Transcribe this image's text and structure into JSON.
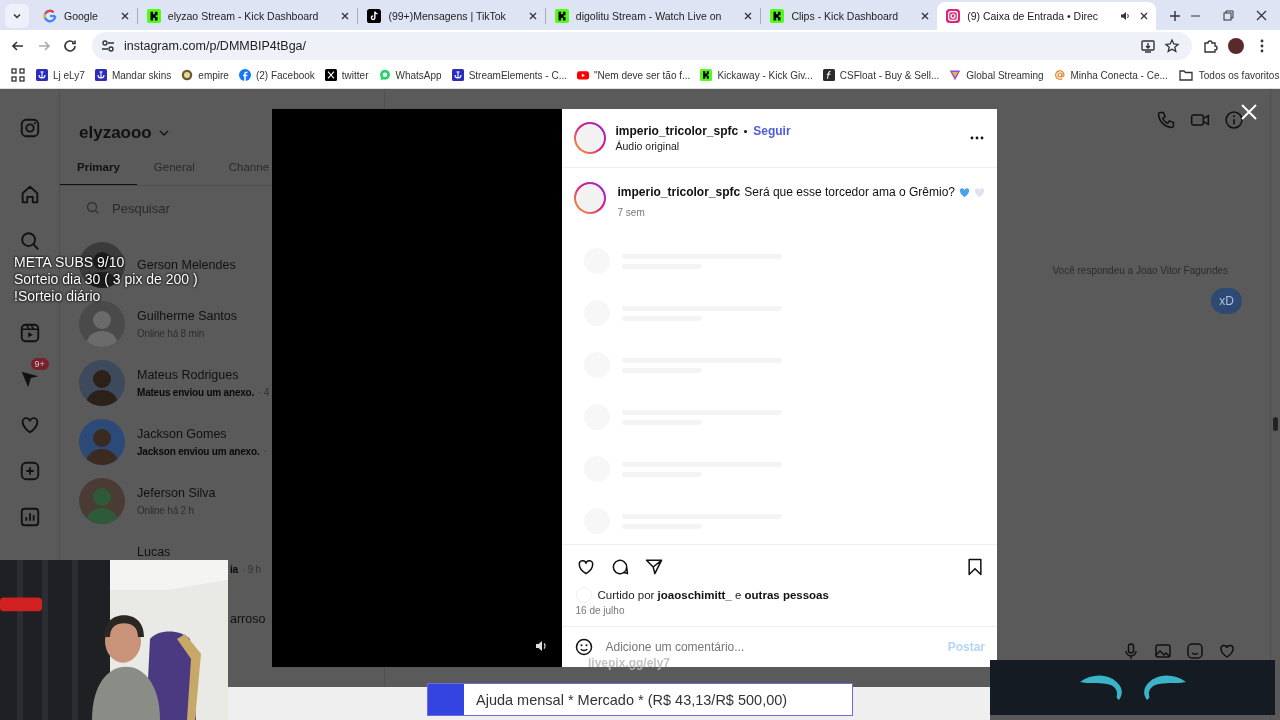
{
  "browser": {
    "tabs": [
      {
        "title": "Google",
        "selected": false,
        "audio": false
      },
      {
        "title": "elyzao Stream - Kick Dashboard",
        "selected": false,
        "audio": false
      },
      {
        "title": "(99+)Mensagens | TikTok",
        "selected": false,
        "audio": false
      },
      {
        "title": "digolitu Stream - Watch Live on",
        "selected": false,
        "audio": false
      },
      {
        "title": "Clips - Kick Dashboard",
        "selected": false,
        "audio": false
      },
      {
        "title": "(9) Caixa de Entrada • Direc",
        "selected": true,
        "audio": true
      }
    ],
    "url": "instagram.com/p/DMMBIP4tBga/",
    "bookmarks": [
      "Lj eLy7",
      "Mandar skins",
      "empire",
      "(2) Facebook",
      "twitter",
      "WhatsApp",
      "StreamElements - C...",
      "\"Nem deve ser tão f...",
      "Kickaway - Kick Giv...",
      "CSFloat - Buy & Sell...",
      "Global Streaming",
      "Minha Conecta - Ce..."
    ],
    "all_bookmarks": "Todos os favoritos"
  },
  "inbox": {
    "account": "elyzaooo",
    "nav_badge": "9+",
    "tabs": [
      {
        "label": "Primary",
        "selected": true
      },
      {
        "label": "General",
        "selected": false
      },
      {
        "label": "Channe",
        "selected": false
      }
    ],
    "search": {
      "placeholder": "Pesquisar"
    },
    "conversations": [
      {
        "name": "Gerson Melendes",
        "kind": "normal"
      },
      {
        "name": "Guilherme Santos",
        "preview": "Online há 8 min",
        "unread": false,
        "kind": "normal"
      },
      {
        "name": "Mateus Rodrigues",
        "preview": "Mateus enviou um anexo.",
        "time": "· 4",
        "unread": true,
        "kind": "normal"
      },
      {
        "name": "Jackson Gomes",
        "preview": "Jackson enviou um anexo.",
        "time": "·",
        "unread": true,
        "kind": "normal"
      },
      {
        "name": "Jeferson Silva",
        "preview": "Online há 2 h",
        "unread": false,
        "kind": "normal"
      },
      {
        "name": "Lucas",
        "preview": "ia",
        "time": "· 9 h",
        "unread": true,
        "kind": "half_covered"
      },
      {
        "name": "arroso",
        "kind": "covered"
      }
    ],
    "chat": {
      "notice": "Você respondeu a Joao Vitor Fagundes",
      "message": "xD"
    }
  },
  "post": {
    "username": "imperio_tricolor_spfc",
    "follow": "Seguir",
    "audio": "Áudio original",
    "caption": {
      "username": "imperio_tricolor_spfc",
      "text": "Será que esse torcedor ama o Grêmio?",
      "age": "7 sem"
    },
    "likes": "Curtido por **joaoschimitt_** e **outras pessoas**",
    "date": "16 de julho",
    "comment": {
      "placeholder": "Adicione um comentário..."
    },
    "post_button": {
      "label": "Postar",
      "disabled": true
    }
  },
  "stream_overlay": {
    "goal_lines": [
      "META SUBS 9/10",
      "Sorteio dia 30 ( 3 pix de 200 )",
      "!Sorteio diário"
    ],
    "livepix": "livepix.gg/ely7",
    "donation_goal": {
      "text": "Ajuda mensal * Mercado * (R$ 43,13/R$ 500,00)",
      "level": 0.086
    }
  }
}
